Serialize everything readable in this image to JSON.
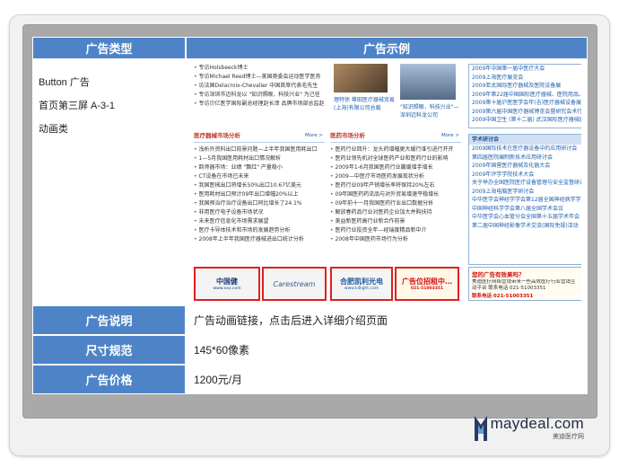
{
  "table": {
    "header": {
      "col1": "广告类型",
      "col2": "广告示例"
    },
    "type_lines": [
      "Button 广告",
      "首页第三屏  A-3-1",
      "动画类"
    ],
    "rows": [
      {
        "label": "广告说明",
        "value": "广告动画链接，点击后进入详细介绍页面"
      },
      {
        "label": "尺寸规范",
        "value": "145*60像素"
      },
      {
        "label": "广告价格",
        "value": "1200元/月"
      }
    ]
  },
  "example": {
    "top_left_lines": [
      "专访Holsbeeck博士",
      "专访Michael Reed博士—美国奥委会运动医学医务",
      "访法国Delacroix-Chevalier 中国首席代表毛先生",
      "专访深圳市迈科龙以 \"知识照眼，科技兴业\" 为己任",
      "专访贝亿医学国际副总经理赵长漳 品牌市场部总监赵"
    ],
    "photo_caption_1": "理特徐 尊田医疗器械贸易(上海)有限公司总裁",
    "photo_caption_2": "\"知识照眼，科技兴业\"—深圳迈科龙公司",
    "left_section": {
      "title": "医疗器械市场分析",
      "more": "More >",
      "items": [
        "浅析外资科出口前景问题—上半年我国医用耗出口",
        "1—5月我国医用耗材出口情况解析",
        "韵师器市场：业绩 \"飘红\" 产量稳小",
        "CT设备在市场已未来",
        "我国医械出口将增长50%出口10.67亿美元",
        "医用耗材出口预计09年出口增幅20%以上",
        "我国预治疗治疗设备出口同比增长了24.1%",
        "非用医疗电子设备市场状况",
        "未来医疗信息化市场需求展望",
        "医疗卡导体技术和市场的发展趋势分析",
        "2008年上半年我国医疗器械进出口统计分析"
      ]
    },
    "mid_section": {
      "title": "医药市场分析",
      "more": "More >",
      "items": [
        "医药行业回升：龙头药增幅更大缓行谁引进行开开",
        "医药业领先机对全球医药产业和医药行业的影响",
        "2009年1-6月我国医药行业赢缓增手增长",
        "2009—中医疗市场医药发展现状分析",
        "医药行业09年产销增长率将保持20%左右",
        "09年国医药药流品与对外贸易增速平稳增长",
        "09年前十一月我国医药行业出口数据分析",
        "解放春药品行业对医药企业加大并购扶持",
        "美益新医药高行业新合作前景",
        "医药行业投资全年—经瑞度精品新中介",
        "2008年中国医药市场行为分析"
      ]
    },
    "right_box_1": {
      "lines": [
        "2009年中国第一届中医疗大会",
        "2009上海医疗展览会",
        "2009亚太国际医疗器械及医院设备展",
        "2009年第22届中国国际医疗器械、医院用品、实",
        "2009第十届沪医医学会年(吉)医疗器械设备展览",
        "2009第六届中国医疗器械博览会暨研究会术行、",
        "2009中国卫生 (第十二届) 武汉国际医疗器械展"
      ]
    },
    "right_box_2": {
      "title": "学术研讨会",
      "lines": [
        "2009国际技术在医疗器设备中的应用研讨会",
        "第四届医院编制新技术应用研讨会",
        "2009年国营医疗器械及化器大会",
        "2009年评学学院技术大会",
        "关于举办全国医院医疗设备管理与安全监督研讨",
        "2009上海电脑医学研讨会",
        "中华医学会神经学学会第12届全国神经病学学术",
        "中国神经科学学会第八届全国学术会议",
        "中华医学会心血管分会全国第十五届学术年会",
        "第二届中国神经影像学术交流(国际免规)活动"
      ]
    },
    "logos": [
      "中国健",
      "Carestream",
      "合肥凯利光电",
      "广告位招租中…"
    ],
    "logo_sub": [
      "www.xxx.com",
      "",
      "www.killight.com",
      "021-51003351"
    ],
    "bottom_ad": {
      "title": "您的广告有效果吗？",
      "body": "美迪医疗网络营销带来一些高效医疗行业营销互动平台 联系电话 021-51003351",
      "contact": "联系电话 021-51003351"
    }
  },
  "brand": {
    "name": "maydeal.com",
    "sub": "美迪医疗网"
  },
  "colors": {
    "header_blue": "#4e84c7",
    "panel_gray": "#a9a9a9",
    "accent_red": "#e02020"
  }
}
